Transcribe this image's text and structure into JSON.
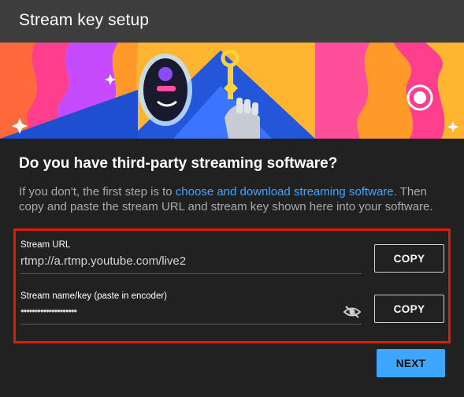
{
  "dialog": {
    "title": "Stream key setup"
  },
  "content": {
    "heading": "Do you have third-party streaming software?",
    "desc_before": "If you don't, the first step is to ",
    "desc_link": "choose and download streaming software",
    "desc_after": ". Then copy and paste the stream URL and stream key shown here into your software."
  },
  "stream_url": {
    "label": "Stream URL",
    "value": "rtmp://a.rtmp.youtube.com/live2",
    "copy_label": "COPY"
  },
  "stream_key": {
    "label": "Stream name/key (paste in encoder)",
    "value": "••••••••••••••••••••",
    "copy_label": "COPY",
    "visibility_icon": "eye-off-icon"
  },
  "footer": {
    "next_label": "NEXT"
  },
  "colors": {
    "background": "#212121",
    "titlebar": "#3d3d3d",
    "accent": "#3ea6ff",
    "highlight_frame": "#e3180c",
    "muted_text": "#aaaaaa"
  }
}
